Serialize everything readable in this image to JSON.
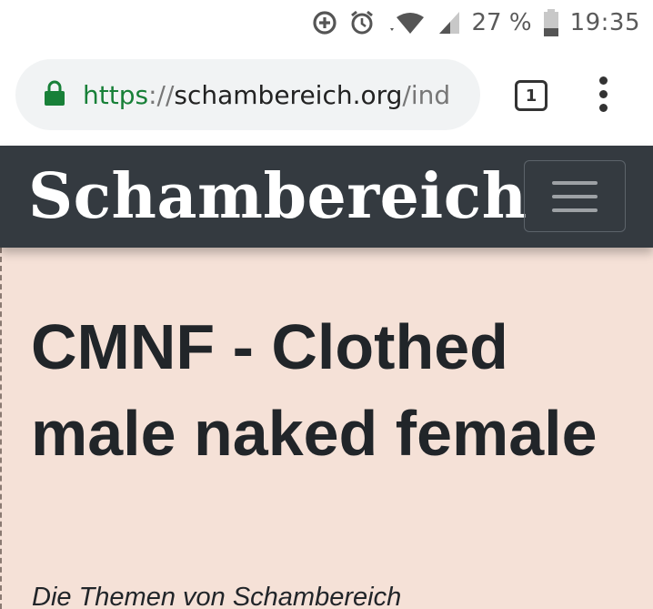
{
  "status_bar": {
    "icons": [
      "data-saver-icon",
      "alarm-icon",
      "wifi-icon",
      "cell-signal-icon",
      "battery-icon"
    ],
    "battery_percent": "27 %",
    "time": "19:35"
  },
  "browser": {
    "url": {
      "scheme": "https",
      "separator": "://",
      "host": "schambereich.org",
      "path": "/ind"
    },
    "tab_count": "1"
  },
  "navbar": {
    "brand": "Schambereich",
    "background_color": "#343a40"
  },
  "page": {
    "title": "CMNF - Clothed male naked female",
    "subtitle": "Die Themen von Schambereich",
    "background_color": "#f5e1d7"
  }
}
